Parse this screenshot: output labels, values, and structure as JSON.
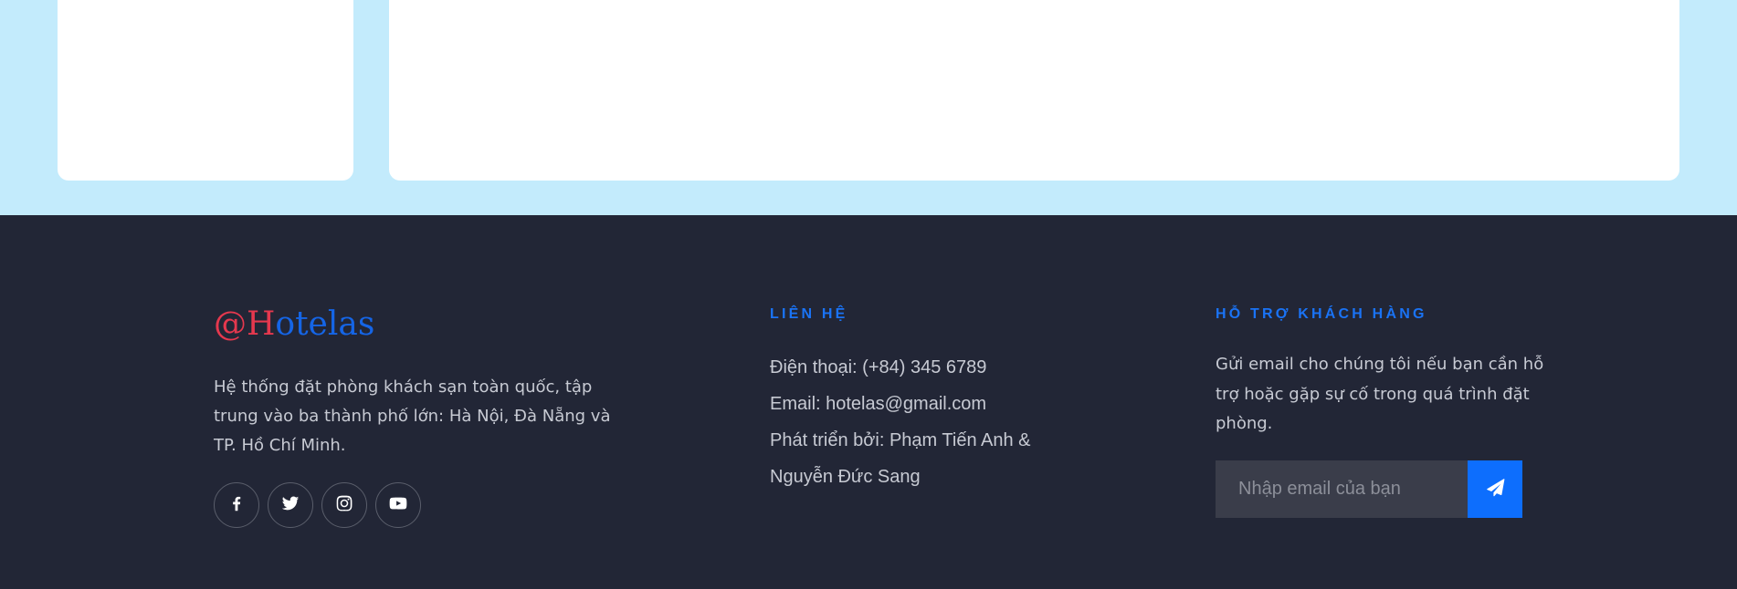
{
  "brand": {
    "logo_prefix": "@H",
    "logo_rest": "otelas",
    "description": "Hệ thống đặt phòng khách sạn toàn quốc, tập trung vào ba thành phố lớn: Hà Nội, Đà Nẵng và TP. Hồ Chí Minh.",
    "socials": [
      {
        "icon": "facebook-icon"
      },
      {
        "icon": "twitter-icon"
      },
      {
        "icon": "instagram-icon"
      },
      {
        "icon": "youtube-icon"
      }
    ]
  },
  "contact": {
    "heading": "LIÊN HỆ",
    "phone": "Điện thoại: (+84) 345 6789",
    "email": "Email: hotelas@gmail.com",
    "developer_line1": "Phát triển bởi: Phạm Tiến Anh &",
    "developer_line2": "Nguyễn Đức Sang"
  },
  "support": {
    "heading": "HỖ TRỢ KHÁCH HÀNG",
    "description": "Gửi email cho chúng tôi nếu bạn cần hỗ trợ hoặc gặp sự cố trong quá trình đặt phòng.",
    "email_placeholder": "Nhập email của bạn",
    "email_value": "",
    "send_icon": "paper-plane-icon"
  },
  "colors": {
    "page_bg": "#c3ebfc",
    "footer_bg": "#222636",
    "accent": "#0d6efd",
    "logo_red": "#e5384e",
    "logo_blue": "#1565e6"
  }
}
